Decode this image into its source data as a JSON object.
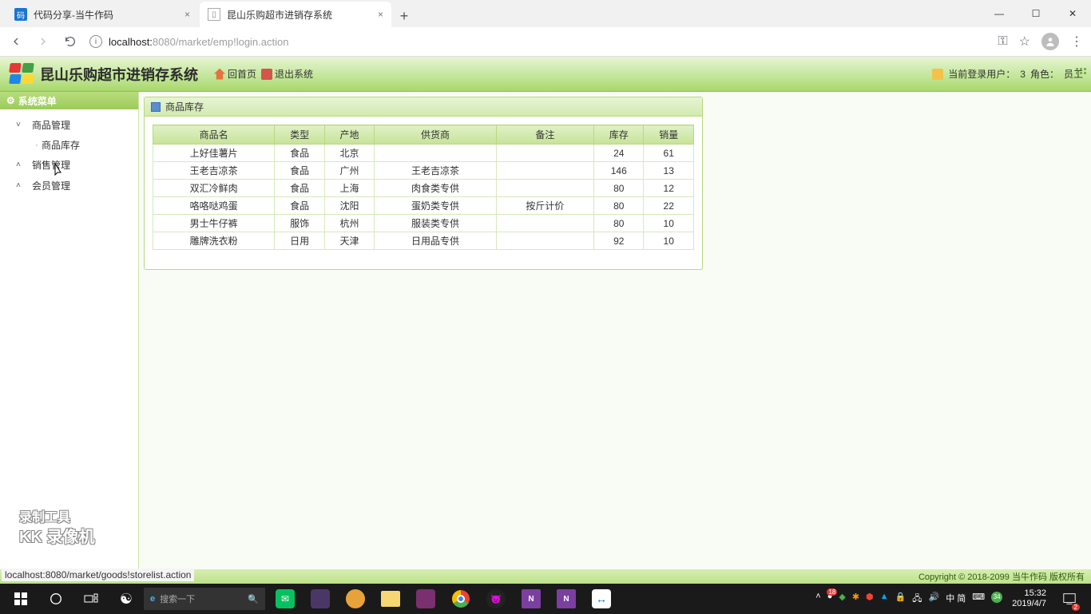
{
  "browser": {
    "tabs": [
      {
        "title": "代码分享-当牛作码"
      },
      {
        "title": "昆山乐购超市进销存系统"
      }
    ],
    "url_host": "localhost:",
    "url_port": "8080",
    "url_path": "/market/emp!login.action"
  },
  "window": {
    "min": "—",
    "max": "☐",
    "close": "✕",
    "new_tab": "+"
  },
  "header": {
    "app_title": "昆山乐购超市进销存系统",
    "home": "回首页",
    "logout": "退出系统",
    "user_label": "当前登录用户：",
    "user_value": "3",
    "role_label": "角色：",
    "role_value": "员工"
  },
  "sidebar": {
    "title": "系统菜单",
    "items": [
      {
        "label": "商品管理",
        "chev": "˅"
      },
      {
        "label": "商品库存",
        "sub": true
      },
      {
        "label": "销售管理",
        "chev": "˄"
      },
      {
        "label": "会员管理",
        "chev": "˄"
      }
    ]
  },
  "panel": {
    "title": "商品库存",
    "columns": [
      "商品名",
      "类型",
      "产地",
      "供货商",
      "备注",
      "库存",
      "销量"
    ],
    "rows": [
      [
        "上好佳薯片",
        "食品",
        "北京",
        "",
        "",
        "24",
        "61"
      ],
      [
        "王老吉凉茶",
        "食品",
        "广州",
        "王老吉凉茶",
        "",
        "146",
        "13"
      ],
      [
        "双汇冷鲜肉",
        "食品",
        "上海",
        "肉食类专供",
        "",
        "80",
        "12"
      ],
      [
        "咯咯哒鸡蛋",
        "食品",
        "沈阳",
        "蛋奶类专供",
        "按斤计价",
        "80",
        "22"
      ],
      [
        "男士牛仔裤",
        "服饰",
        "杭州",
        "服装类专供",
        "",
        "80",
        "10"
      ],
      [
        "雕牌洗衣粉",
        "日用",
        "天津",
        "日用品专供",
        "",
        "92",
        "10"
      ]
    ]
  },
  "footer": {
    "status": "localhost:8080/market/goods!storelist.action",
    "copyright": "Copyright © 2018-2099 当牛作码 版权所有"
  },
  "watermark": {
    "l1": "录制工具",
    "l2": "KK 录像机"
  },
  "taskbar": {
    "search_placeholder": "搜索一下",
    "time": "15:32",
    "date": "2019/4/7",
    "ime": "中 简",
    "notif_count": "2",
    "badge18": "18"
  }
}
